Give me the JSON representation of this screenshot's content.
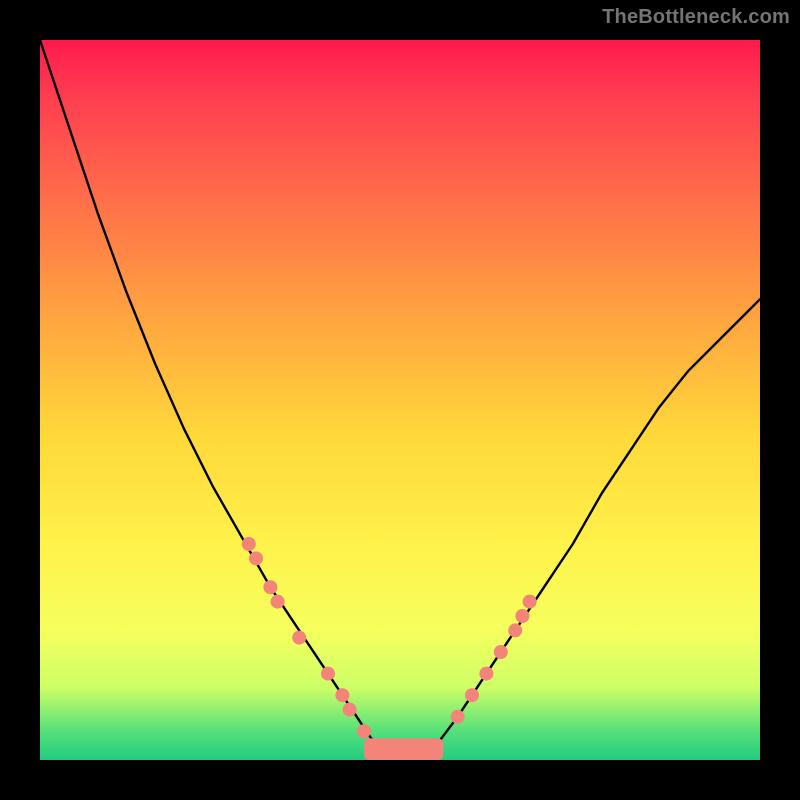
{
  "watermark": "TheBottleneck.com",
  "chart_data": {
    "type": "line",
    "title": "",
    "xlabel": "",
    "ylabel": "",
    "xlim": [
      0,
      100
    ],
    "ylim": [
      0,
      100
    ],
    "grid": false,
    "legend": false,
    "gradient": {
      "top": "#ff1a4d",
      "mid": "#ffd83a",
      "bottom": "#22cc80"
    },
    "series": [
      {
        "name": "curve",
        "color": "#000000",
        "x": [
          0,
          4,
          8,
          12,
          16,
          20,
          24,
          28,
          32,
          36,
          40,
          42,
          44,
          46,
          48,
          50,
          52,
          55,
          58,
          62,
          66,
          70,
          74,
          78,
          82,
          86,
          90,
          94,
          98,
          100
        ],
        "y": [
          100,
          88,
          76,
          65,
          55,
          46,
          38,
          31,
          24,
          18,
          12,
          9,
          6,
          3,
          1,
          0,
          0,
          2,
          6,
          12,
          18,
          24,
          30,
          37,
          43,
          49,
          54,
          58,
          62,
          64
        ]
      }
    ],
    "markers": {
      "name": "dots",
      "color": "#f2847a",
      "radius": 7,
      "points": [
        {
          "x": 29,
          "y": 30
        },
        {
          "x": 30,
          "y": 28
        },
        {
          "x": 32,
          "y": 24
        },
        {
          "x": 33,
          "y": 22
        },
        {
          "x": 36,
          "y": 17
        },
        {
          "x": 40,
          "y": 12
        },
        {
          "x": 42,
          "y": 9
        },
        {
          "x": 43,
          "y": 7
        },
        {
          "x": 45,
          "y": 4
        },
        {
          "x": 58,
          "y": 6
        },
        {
          "x": 60,
          "y": 9
        },
        {
          "x": 62,
          "y": 12
        },
        {
          "x": 64,
          "y": 15
        },
        {
          "x": 66,
          "y": 18
        },
        {
          "x": 67,
          "y": 20
        },
        {
          "x": 68,
          "y": 22
        }
      ]
    },
    "valley_bar": {
      "color": "#f2847a",
      "x0": 45,
      "x1": 56,
      "y": 0,
      "height": 3
    }
  }
}
